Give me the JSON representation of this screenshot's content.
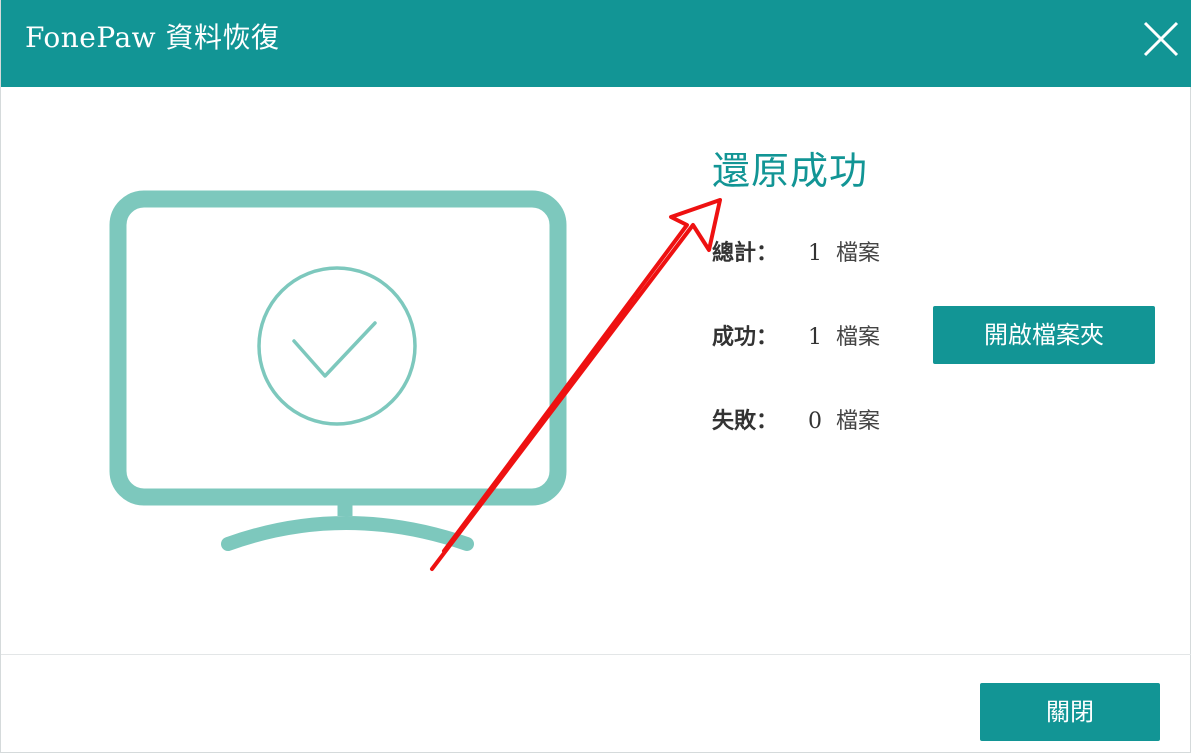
{
  "window": {
    "title": "FonePaw 資料恢復",
    "accent_color": "#129595",
    "close_icon": "close-icon"
  },
  "illustration": {
    "icon": "monitor-check-icon",
    "color": "#7dc8bd"
  },
  "result": {
    "heading": "還原成功",
    "stats": [
      {
        "label": "總計：",
        "value": "1",
        "unit": "檔案"
      },
      {
        "label": "成功：",
        "value": "1",
        "unit": "檔案"
      },
      {
        "label": "失敗：",
        "value": "0",
        "unit": "檔案"
      }
    ],
    "open_folder_label": "開啟檔案夾"
  },
  "footer": {
    "close_label": "關閉"
  },
  "annotation": {
    "icon": "red-arrow-icon",
    "color": "#ee1111"
  }
}
